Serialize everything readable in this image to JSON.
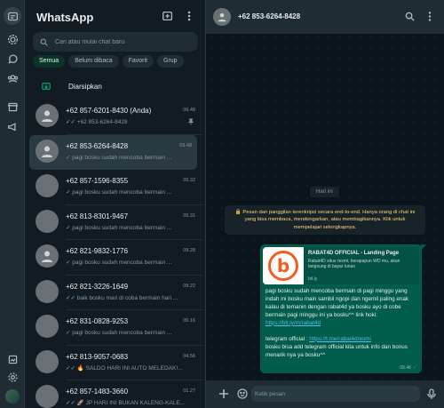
{
  "app": {
    "title": "WhatsApp"
  },
  "colors": {
    "accent": "#00a884",
    "background": "#111b21",
    "panel": "#202c33",
    "bubble_out": "#005c4b",
    "encryption_text": "#ffd279",
    "read_tick": "#53bdeb"
  },
  "rail": {
    "top_icons": [
      "chats-icon",
      "status-icon",
      "channels-icon",
      "communities-icon"
    ],
    "middle_icons": [
      "business-tools-icon",
      "announcements-icon"
    ],
    "bottom_icons": [
      "media-icon",
      "settings-icon",
      "profile-avatar"
    ]
  },
  "search": {
    "placeholder": "Cari atau mulai chat baru"
  },
  "filters": [
    {
      "label": "Semua",
      "active": true
    },
    {
      "label": "Belum dibaca",
      "active": false
    },
    {
      "label": "Favorit",
      "active": false
    },
    {
      "label": "Grup",
      "active": false
    }
  ],
  "archived": {
    "label": "Diarsipkan"
  },
  "chats": [
    {
      "name": "+62 857-6201-8430 (Anda)",
      "time": "09.48",
      "preview": "+62 853-6264-8428",
      "tick": "double-blue",
      "pinned": true,
      "avatar": "default"
    },
    {
      "name": "+62 853-6264-8428",
      "time": "09.48",
      "preview": "pagi bosku sudah mencoba bermain ...",
      "tick": "single",
      "selected": true,
      "avatar": "default"
    },
    {
      "name": "+62 857-1596-8355",
      "time": "09.32",
      "preview": "pagi bosku sudah mencoba bermain ...",
      "tick": "single",
      "avatar": "photo1"
    },
    {
      "name": "+62 813-8301-9467",
      "time": "09.31",
      "preview": "pagi bosku sudah mencoba bermain ...",
      "tick": "single",
      "avatar": "photo2"
    },
    {
      "name": "+62 821-9832-1776",
      "time": "09.28",
      "preview": "pagi bosku sudah mencoba bermain ...",
      "tick": "single",
      "avatar": "default"
    },
    {
      "name": "+62 821-3226-1649",
      "time": "09.22",
      "preview": "baik bosku mari di coba bermain hari ...",
      "tick": "double-blue",
      "avatar": "photo4"
    },
    {
      "name": "+62 831-0828-9253",
      "time": "09.16",
      "preview": "pagi bosku sudah mencoba bermain ...",
      "tick": "single",
      "avatar": "photo5"
    },
    {
      "name": "+62 813-9057-0683",
      "time": "04.56",
      "preview": "🔥 SALDO HARI INI AUTO MELEDAK!...",
      "tick": "double-blue",
      "avatar": "photo6"
    },
    {
      "name": "+62 857-1483-3660",
      "time": "01.27",
      "preview": "🚀 JP HARI INI BUKAN KALENG-KALE...",
      "tick": "double-blue",
      "avatar": "photo7"
    }
  ],
  "conversation": {
    "contact": "+62 853-6264-8428",
    "day_label": "Hari ini",
    "encryption_notice": "🔒 Pesan dan panggilan terenkripsi secara end-to-end. Hanya orang di chat ini yang bisa membaca, mendengarkan, atau membagikannya. Klik untuk mempelajari selengkapnya.",
    "message": {
      "link_preview": {
        "title": "RABAT4D OFFICIAL - Landing Page",
        "description": "Rabat4D situs resmi, berapapun WD mu, akan langsung di bayar lunas",
        "domain": "bit.ly",
        "logo_letter": "b"
      },
      "text_1": "pagi bosku sudah mencoba bermain di pagi minggu yang indah ini bosku main sambil  ngopi dan ngemil paling enak kalau di temanin dengan rabat4d ya bosku ayo di cobe bermain pagi minggu ini ya bosku^^   link hoki: ",
      "link_1": "https://bit.ly/m/rabat4d",
      "text_2": "telegram official : ",
      "link_2": "https://t.me/rabat4dresmi",
      "text_3": "bosku bisa add telegram official kita untuk info dan bonus menarik nya ya bosku^^",
      "time": "09.48"
    },
    "composer_placeholder": "Ketik pesan"
  }
}
